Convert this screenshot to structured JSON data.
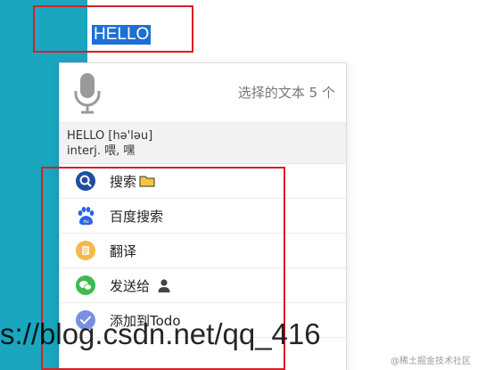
{
  "selection": {
    "text": "HELLO"
  },
  "popup": {
    "selected_count": "选择的文本 5 个",
    "dictionary": {
      "word": "HELLO [hə'ləu]",
      "definition": "interj. 喂, 嘿"
    },
    "menu": [
      {
        "label": "搜索",
        "icon": "search-icon",
        "color": "#1e4da1"
      },
      {
        "label": "百度搜索",
        "icon": "baidu-paw-icon",
        "color": "#2a62e6"
      },
      {
        "label": "翻译",
        "icon": "translate-icon",
        "color": "#f5b94a"
      },
      {
        "label": "发送给",
        "icon": "wechat-icon",
        "color": "#3fba4e"
      },
      {
        "label": "添加到Todo",
        "icon": "todo-check-icon",
        "color": "#7b8ee0"
      }
    ]
  },
  "watermark": {
    "url_text": "s://blog.csdn.net/qq_416",
    "source": "@稀土掘金技术社区"
  },
  "colors": {
    "accent_teal": "#1aa6bf",
    "selection_blue": "#1e6fd6",
    "highlight_red": "#d81e27"
  }
}
